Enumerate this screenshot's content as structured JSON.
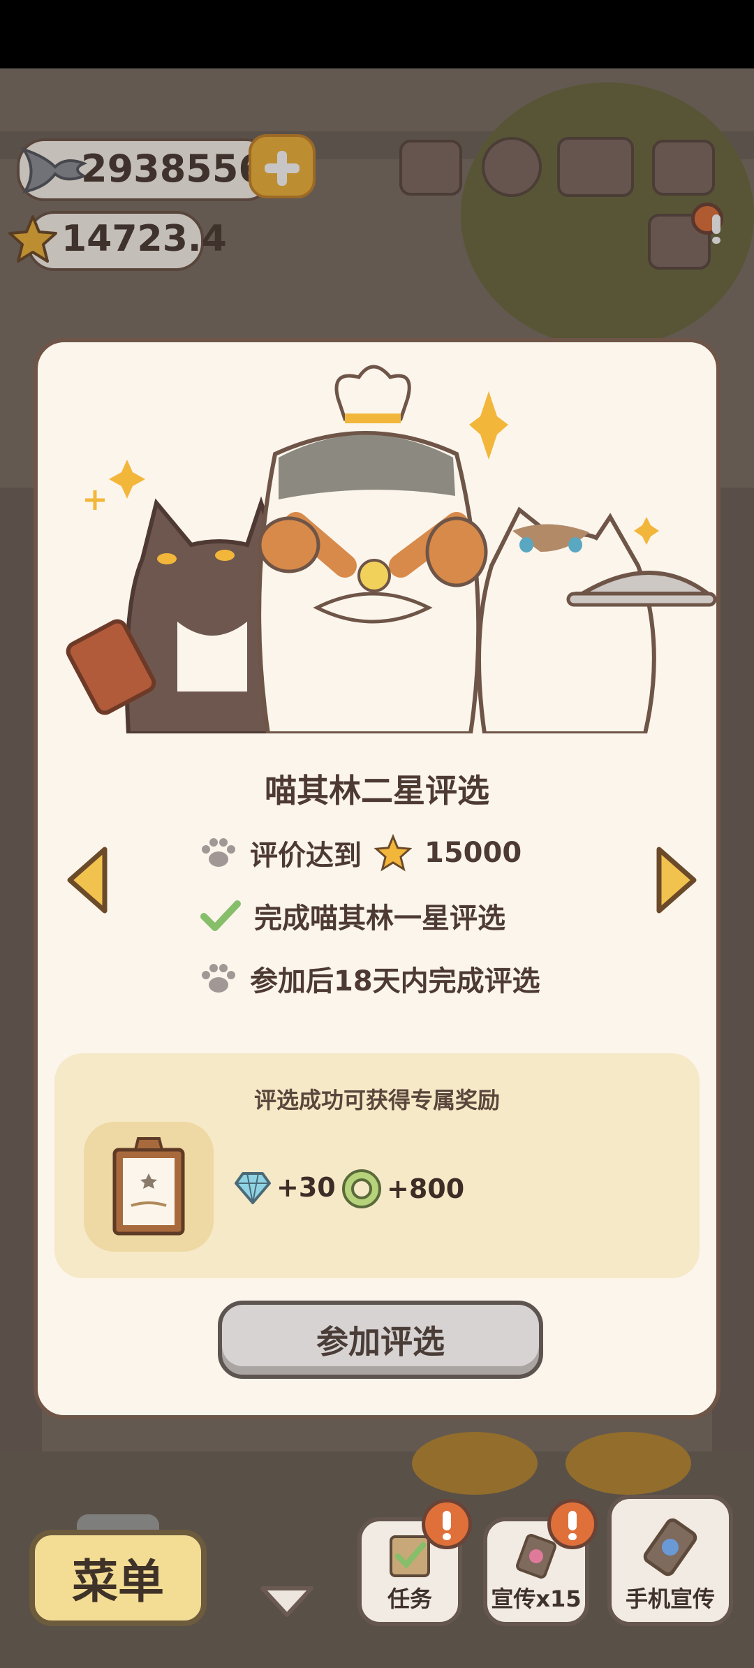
{
  "hud": {
    "fish_count": "2938556",
    "star_count": "14723.4"
  },
  "modal": {
    "title": "喵其林二星评选",
    "requirements": [
      {
        "icon": "paw-icon",
        "text": "评价达到",
        "value": "15000"
      },
      {
        "icon": "check-icon",
        "text": "完成喵其林一星评选"
      },
      {
        "icon": "paw-icon",
        "text": "参加后18天内完成评选"
      }
    ],
    "reward": {
      "title": "评选成功可获得专属奖励",
      "items": [
        {
          "icon": "diamond-icon",
          "amount": "+30"
        },
        {
          "icon": "coin-ring-icon",
          "amount": "+800"
        }
      ]
    },
    "join_button": "参加评选"
  },
  "bottom_bar": {
    "menu_label": "菜单",
    "tasks_label": "任务",
    "promo_label": "宣传x15",
    "phone_promo_label": "手机宣传"
  },
  "colors": {
    "modal_bg": "#fbf5ec",
    "reward_bg": "#f6e9c7",
    "accent_gold": "#f2b63a",
    "check_green": "#86be6a",
    "alert_orange": "#e0703a"
  }
}
